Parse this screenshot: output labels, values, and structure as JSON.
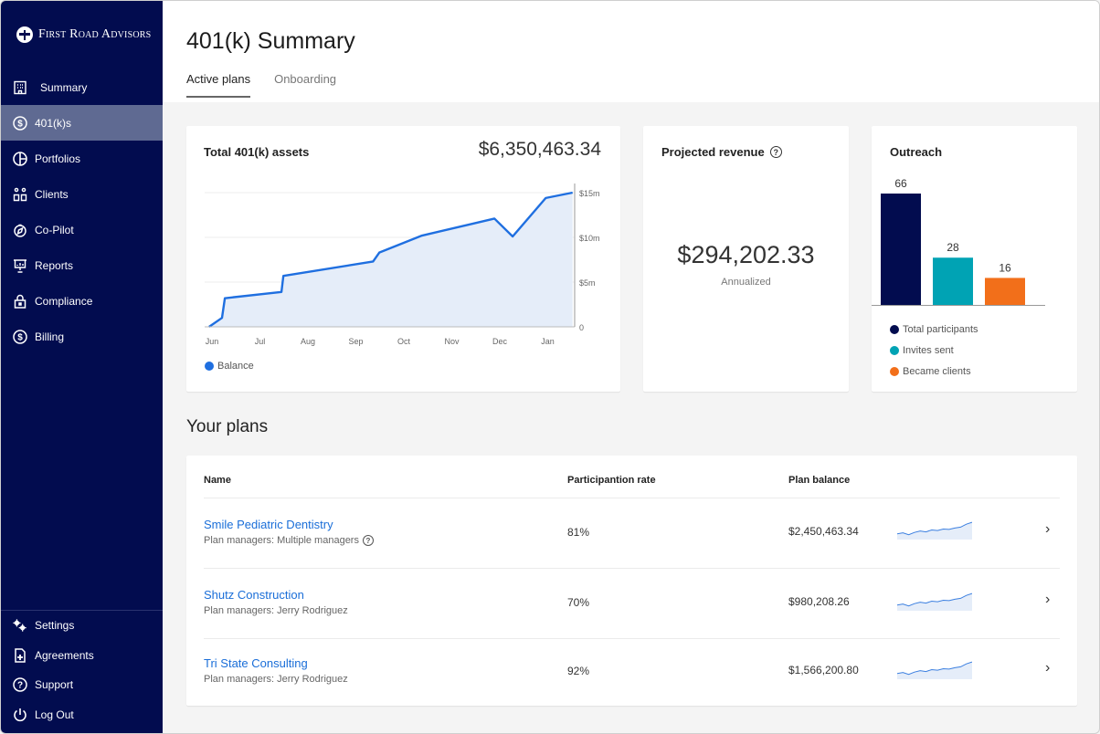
{
  "brand": {
    "name": "First Road Advisors"
  },
  "sidebar": {
    "items": [
      {
        "label": "Summary",
        "icon": "building-icon"
      },
      {
        "label": "401(k)s",
        "icon": "dollar-circle-icon",
        "active": true
      },
      {
        "label": "Portfolios",
        "icon": "pie-chart-icon"
      },
      {
        "label": "Clients",
        "icon": "people-icon"
      },
      {
        "label": "Co-Pilot",
        "icon": "compass-icon"
      },
      {
        "label": "Reports",
        "icon": "presentation-icon"
      },
      {
        "label": "Compliance",
        "icon": "lock-icon"
      },
      {
        "label": "Billing",
        "icon": "dollar-circle-icon"
      }
    ],
    "bottom_items": [
      {
        "label": "Settings",
        "icon": "gears-icon"
      },
      {
        "label": "Agreements",
        "icon": "document-plus-icon"
      },
      {
        "label": "Support",
        "icon": "help-circle-icon"
      },
      {
        "label": "Log Out",
        "icon": "power-icon"
      }
    ]
  },
  "header": {
    "title": "401(k) Summary",
    "tabs": [
      {
        "label": "Active plans",
        "active": true
      },
      {
        "label": "Onboarding",
        "active": false
      }
    ]
  },
  "assets_card": {
    "title": "Total 401(k) assets",
    "total": "$6,350,463.34",
    "legend": "Balance"
  },
  "revenue_card": {
    "title": "Projected revenue",
    "value": "$294,202.33",
    "subtitle": "Annualized"
  },
  "outreach_card": {
    "title": "Outreach"
  },
  "plans_section": {
    "title": "Your plans",
    "columns": [
      "Name",
      "Participantion rate",
      "Plan balance"
    ],
    "rows": [
      {
        "name": "Smile Pediatric Dentistry",
        "managers": "Plan managers: Multiple managers",
        "has_help": true,
        "rate": "81%",
        "balance": "$2,450,463.34"
      },
      {
        "name": "Shutz Construction",
        "managers": "Plan managers: Jerry Rodriguez",
        "has_help": false,
        "rate": "70%",
        "balance": "$980,208.26"
      },
      {
        "name": "Tri State Consulting",
        "managers": "Plan managers: Jerry Rodriguez",
        "has_help": false,
        "rate": "92%",
        "balance": "$1,566,200.80"
      }
    ],
    "sparkline": [
      0.35,
      0.4,
      0.3,
      0.42,
      0.5,
      0.45,
      0.55,
      0.52,
      0.6,
      0.58,
      0.65,
      0.7,
      0.85,
      0.95
    ]
  },
  "colors": {
    "sidebar_bg": "#020c4f",
    "accent_blue": "#1a6ed8",
    "line_blue": "#1f6fe0",
    "teal": "#00a3b4",
    "orange": "#f26f1a"
  },
  "chart_data": [
    {
      "type": "area",
      "title": "Total 401(k) assets",
      "x_tick_labels": [
        "Jun",
        "Jul",
        "Aug",
        "Sep",
        "Oct",
        "Nov",
        "Dec",
        "Jan"
      ],
      "y_tick_labels": [
        "0",
        "$5m",
        "$10m",
        "$15m"
      ],
      "ylim": [
        0,
        15
      ],
      "y_unit": "millions USD",
      "grid": true,
      "legend": "bottom-left",
      "series": [
        {
          "name": "Balance",
          "x": [
            -0.08,
            0.19,
            0.25,
            1.43,
            1.47,
            3.34,
            3.47,
            4.36,
            5.87,
            6.25,
            6.94,
            7.5
          ],
          "y": [
            0,
            1.0,
            3.2,
            3.9,
            5.7,
            7.3,
            8.3,
            10.2,
            12.1,
            10.1,
            14.4,
            15.0
          ]
        }
      ]
    },
    {
      "type": "bar",
      "title": "Outreach",
      "categories": [
        "Total participants",
        "Invites sent",
        "Became clients"
      ],
      "values": [
        66,
        28,
        16
      ],
      "colors": [
        "#020c4f",
        "#00a3b4",
        "#f26f1a"
      ],
      "legend": "bottom-left"
    }
  ]
}
